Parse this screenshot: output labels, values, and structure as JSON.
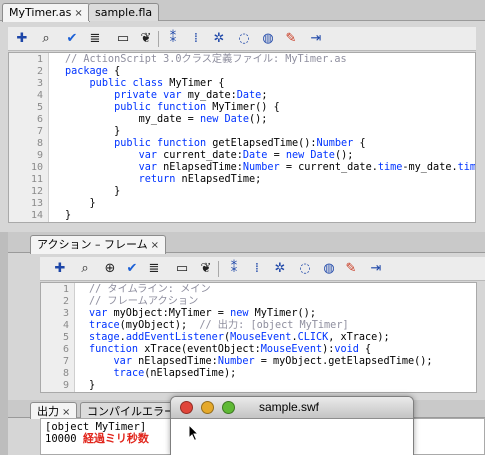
{
  "editor_tabs": [
    "MyTimer.as",
    "sample.fla"
  ],
  "tab_close_glyph": "×",
  "toolbar_icons": [
    "add-statement-icon",
    "find-icon",
    "insert-target-path-icon",
    "check-syntax-icon",
    "auto-format-icon",
    "show-code-hint-icon",
    "debug-options-icon",
    "collapse-between-braces-icon",
    "collapse-selection-icon",
    "expand-all-icon",
    "apply-block-comment-icon",
    "apply-line-comment-icon",
    "remove-comment-icon",
    "show-hide-toolbox-icon"
  ],
  "script_code": {
    "line_numbers": [
      "1",
      "2",
      "3",
      "4",
      "5",
      "6",
      "7",
      "8",
      "9",
      "10",
      "11",
      "12",
      "13",
      "14"
    ],
    "lines": [
      [
        {
          "t": "// ActionScript 3.0クラス定義ファイル: MyTimer.as",
          "c": "c"
        }
      ],
      [
        {
          "t": "package",
          "c": "k"
        },
        {
          "t": " {",
          "c": ""
        }
      ],
      [
        {
          "t": "    ",
          "c": ""
        },
        {
          "t": "public",
          "c": "k"
        },
        {
          "t": " ",
          "c": ""
        },
        {
          "t": "class",
          "c": "k"
        },
        {
          "t": " MyTimer {",
          "c": ""
        }
      ],
      [
        {
          "t": "        ",
          "c": ""
        },
        {
          "t": "private",
          "c": "k"
        },
        {
          "t": " ",
          "c": ""
        },
        {
          "t": "var",
          "c": "k"
        },
        {
          "t": " my_date:",
          "c": ""
        },
        {
          "t": "Date",
          "c": "t"
        },
        {
          "t": ";",
          "c": ""
        }
      ],
      [
        {
          "t": "        ",
          "c": ""
        },
        {
          "t": "public",
          "c": "k"
        },
        {
          "t": " ",
          "c": ""
        },
        {
          "t": "function",
          "c": "k"
        },
        {
          "t": " MyTimer() {",
          "c": ""
        }
      ],
      [
        {
          "t": "            my_date = ",
          "c": ""
        },
        {
          "t": "new",
          "c": "k"
        },
        {
          "t": " ",
          "c": ""
        },
        {
          "t": "Date",
          "c": "t"
        },
        {
          "t": "();",
          "c": ""
        }
      ],
      [
        {
          "t": "        }",
          "c": ""
        }
      ],
      [
        {
          "t": "        ",
          "c": ""
        },
        {
          "t": "public",
          "c": "k"
        },
        {
          "t": " ",
          "c": ""
        },
        {
          "t": "function",
          "c": "k"
        },
        {
          "t": " getElapsedTime():",
          "c": ""
        },
        {
          "t": "Number",
          "c": "t"
        },
        {
          "t": " {",
          "c": ""
        }
      ],
      [
        {
          "t": "            ",
          "c": ""
        },
        {
          "t": "var",
          "c": "k"
        },
        {
          "t": " current_date:",
          "c": ""
        },
        {
          "t": "Date",
          "c": "t"
        },
        {
          "t": " = ",
          "c": ""
        },
        {
          "t": "new",
          "c": "k"
        },
        {
          "t": " ",
          "c": ""
        },
        {
          "t": "Date",
          "c": "t"
        },
        {
          "t": "();",
          "c": ""
        }
      ],
      [
        {
          "t": "            ",
          "c": ""
        },
        {
          "t": "var",
          "c": "k"
        },
        {
          "t": " nElapsedTime:",
          "c": ""
        },
        {
          "t": "Number",
          "c": "t"
        },
        {
          "t": " = current_date.",
          "c": ""
        },
        {
          "t": "time",
          "c": "k"
        },
        {
          "t": "-my_date.",
          "c": ""
        },
        {
          "t": "time",
          "c": "k"
        },
        {
          "t": ";",
          "c": ""
        }
      ],
      [
        {
          "t": "            ",
          "c": ""
        },
        {
          "t": "return",
          "c": "k"
        },
        {
          "t": " nElapsedTime;",
          "c": ""
        }
      ],
      [
        {
          "t": "        }",
          "c": ""
        }
      ],
      [
        {
          "t": "    }",
          "c": ""
        }
      ],
      [
        {
          "t": "}",
          "c": ""
        }
      ]
    ]
  },
  "actions_panel": {
    "tab_label": "アクション – フレーム",
    "close_glyph": "×",
    "line_numbers": [
      "1",
      "2",
      "3",
      "4",
      "5",
      "6",
      "7",
      "8",
      "9"
    ],
    "lines": [
      [
        {
          "t": "// タイムライン: メイン",
          "c": "c"
        }
      ],
      [
        {
          "t": "// フレームアクション",
          "c": "c"
        }
      ],
      [
        {
          "t": "var",
          "c": "k"
        },
        {
          "t": " myObject:MyTimer = ",
          "c": ""
        },
        {
          "t": "new",
          "c": "k"
        },
        {
          "t": " MyTimer();",
          "c": ""
        }
      ],
      [
        {
          "t": "trace",
          "c": "k"
        },
        {
          "t": "(myObject);  ",
          "c": ""
        },
        {
          "t": "// 出力: [object MyTimer]",
          "c": "c"
        }
      ],
      [
        {
          "t": "stage",
          "c": "k"
        },
        {
          "t": ".",
          "c": ""
        },
        {
          "t": "addEventListener",
          "c": "k"
        },
        {
          "t": "(",
          "c": ""
        },
        {
          "t": "MouseEvent",
          "c": "t"
        },
        {
          "t": ".",
          "c": ""
        },
        {
          "t": "CLICK",
          "c": "k"
        },
        {
          "t": ", xTrace);",
          "c": ""
        }
      ],
      [
        {
          "t": "function",
          "c": "k"
        },
        {
          "t": " xTrace(eventObject:",
          "c": ""
        },
        {
          "t": "MouseEvent",
          "c": "t"
        },
        {
          "t": "):",
          "c": ""
        },
        {
          "t": "void",
          "c": "k"
        },
        {
          "t": " {",
          "c": ""
        }
      ],
      [
        {
          "t": "    ",
          "c": ""
        },
        {
          "t": "var",
          "c": "k"
        },
        {
          "t": " nElapsedTime:",
          "c": ""
        },
        {
          "t": "Number",
          "c": "t"
        },
        {
          "t": " = myObject.getElapsedTime();",
          "c": ""
        }
      ],
      [
        {
          "t": "    ",
          "c": ""
        },
        {
          "t": "trace",
          "c": "k"
        },
        {
          "t": "(nElapsedTime);",
          "c": ""
        }
      ],
      [
        {
          "t": "}",
          "c": ""
        }
      ]
    ]
  },
  "output_panel": {
    "tabs": [
      "出力",
      "コンパイルエラー"
    ],
    "close_glyph": "×",
    "lines": [
      "[object MyTimer]",
      "10000"
    ],
    "annotation": "経過ミリ秒数"
  },
  "swf_window": {
    "title": "sample.swf"
  },
  "colors": {
    "keyword": "#0033ff",
    "comment": "#8f8f9f",
    "annotation": "#e1251b",
    "close_light": "#e0453a",
    "minimize_light": "#e5a92b",
    "zoom_light": "#5fb935"
  }
}
